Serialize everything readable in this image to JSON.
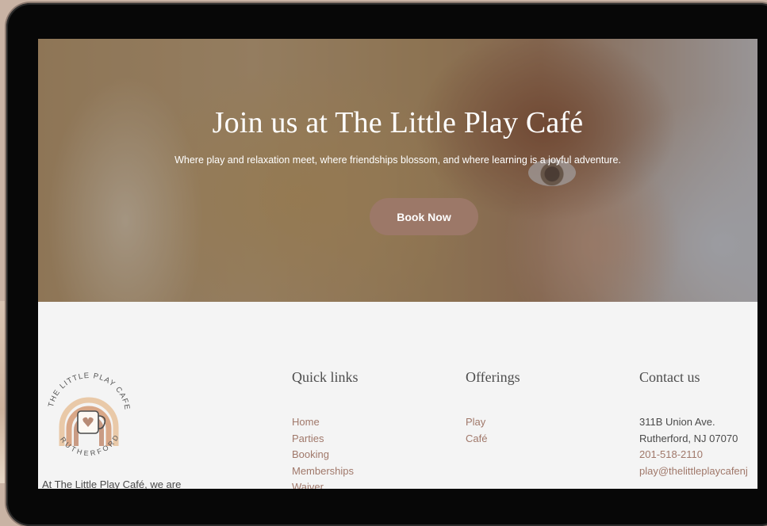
{
  "hero": {
    "title": "Join us at The Little Play Café",
    "subtitle": "Where play and relaxation meet, where friendships blossom, and where learning is a joyful adventure.",
    "cta_label": "Book Now"
  },
  "footer": {
    "logo": {
      "top_text": "THE LITTLE PLAY CAFE",
      "bottom_text": "RUTHERFORD"
    },
    "about_text": "At The Little Play Café, we are",
    "quick_links": {
      "title": "Quick links",
      "items": [
        "Home",
        "Parties",
        "Booking",
        "Memberships",
        "Waiver"
      ]
    },
    "offerings": {
      "title": "Offerings",
      "items": [
        "Play",
        "Café"
      ]
    },
    "contact": {
      "title": "Contact us",
      "address_line1": "311B Union Ave.",
      "address_line2": "Rutherford, NJ 07070",
      "phone": "201-518-2110",
      "email": "play@thelittleplaycafenj"
    }
  },
  "colors": {
    "accent": "#9c7868",
    "link": "#a0786a",
    "footer_bg": "#f4f4f4",
    "device_frame": "#070707"
  }
}
